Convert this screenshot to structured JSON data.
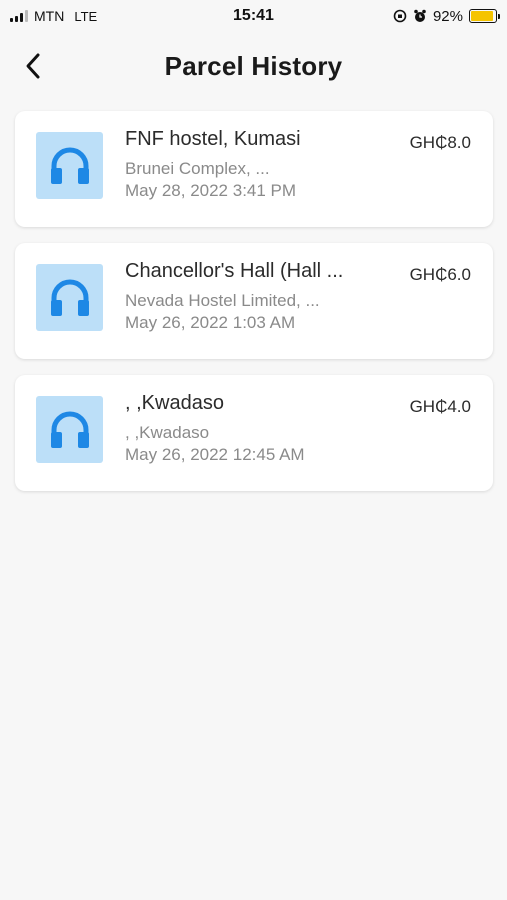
{
  "status_bar": {
    "carrier": "MTN",
    "network": "LTE",
    "time": "15:41",
    "battery": "92%",
    "battery_level": 0.92,
    "battery_color": "#f5c400"
  },
  "header": {
    "back_icon": "chevron-left-icon",
    "title": "Parcel History"
  },
  "parcels": [
    {
      "icon": "headphones-icon",
      "title": "FNF hostel, Kumasi",
      "subtitle": "Brunei Complex, ...",
      "date": "May 28, 2022 3:41 PM",
      "price": "GH₵8.0"
    },
    {
      "icon": "headphones-icon",
      "title": "Chancellor's Hall (Hall ...",
      "subtitle": "Nevada Hostel Limited, ...",
      "date": "May 26, 2022 1:03 AM",
      "price": "GH₵6.0"
    },
    {
      "icon": "headphones-icon",
      "title": ", ,Kwadaso",
      "subtitle": ", ,Kwadaso",
      "date": "May 26, 2022 12:45 AM",
      "price": "GH₵4.0"
    }
  ],
  "colors": {
    "icon_bg": "#bcdff8",
    "icon_fg": "#1e88e5",
    "background": "#f7f7f7"
  }
}
